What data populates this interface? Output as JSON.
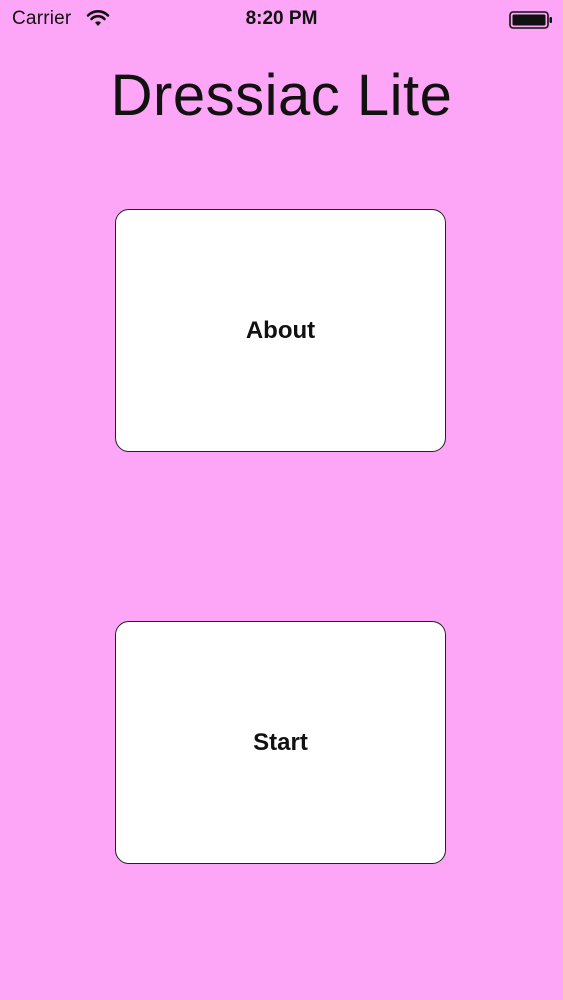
{
  "status_bar": {
    "carrier": "Carrier",
    "time": "8:20 PM",
    "wifi_icon": "wifi-icon",
    "battery_icon": "battery-icon"
  },
  "app": {
    "title": "Dressiac Lite",
    "background_color": "#fda5f6"
  },
  "buttons": {
    "about_label": "About",
    "start_label": "Start"
  }
}
